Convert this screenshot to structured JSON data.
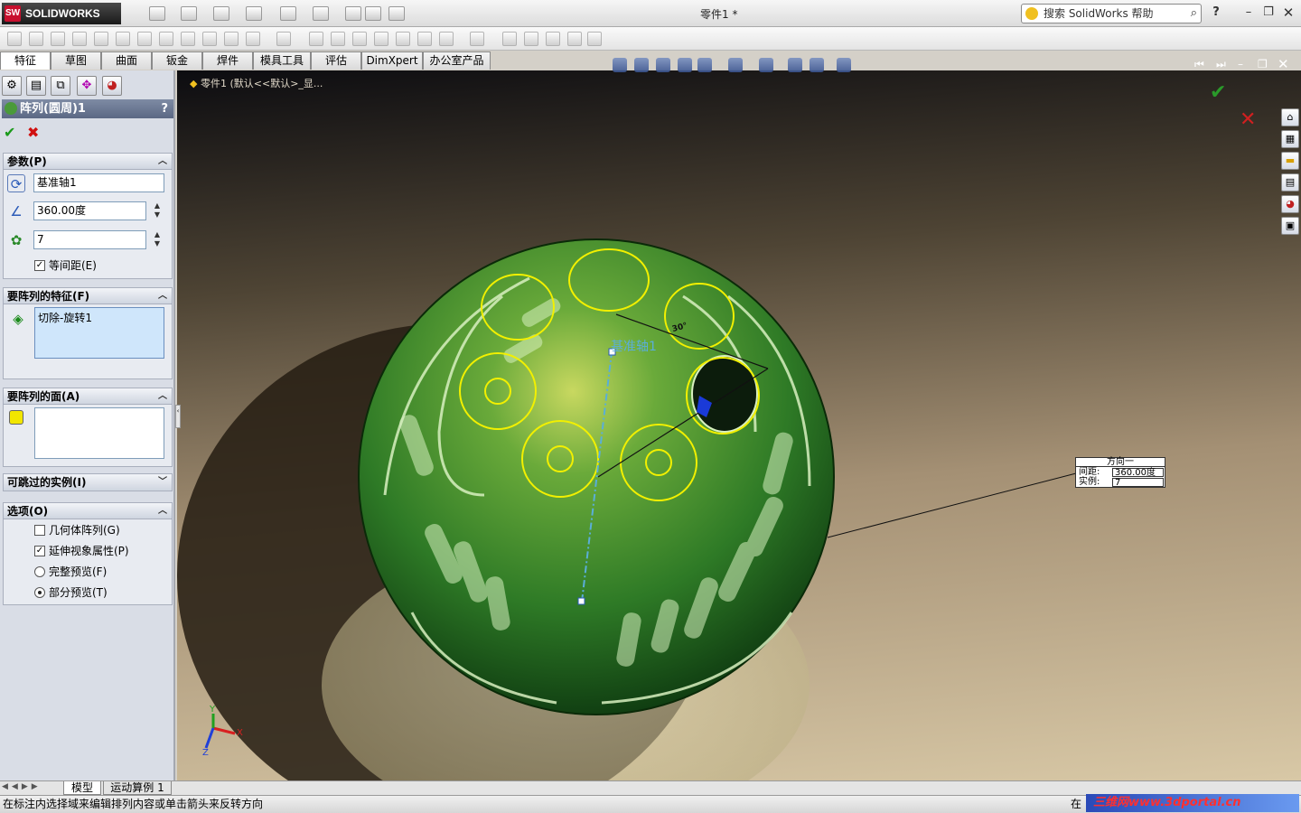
{
  "app": {
    "brand": "SOLIDWORKS",
    "document_title": "零件1 *",
    "search_placeholder": "搜索 SolidWorks 帮助",
    "help_label": "?"
  },
  "command_tabs": [
    {
      "label": "特征",
      "active": true
    },
    {
      "label": "草图"
    },
    {
      "label": "曲面"
    },
    {
      "label": "钣金"
    },
    {
      "label": "焊件"
    },
    {
      "label": "模具工具"
    },
    {
      "label": "评估"
    },
    {
      "label": "DimXpert"
    },
    {
      "label": "办公室产品"
    }
  ],
  "property_manager": {
    "title": "阵列(圆周)1",
    "help": "?",
    "ok_symbol": "✔",
    "cancel_symbol": "✖",
    "groups": {
      "parameters": {
        "title": "参数(P)",
        "axis_value": "基准轴1",
        "angle_value": "360.00度",
        "instances_value": "7",
        "equal_spacing_label": "等间距(E)",
        "equal_spacing_checked": true
      },
      "features": {
        "title": "要阵列的特征(F)",
        "items": [
          "切除-旋转1"
        ]
      },
      "faces": {
        "title": "要阵列的面(A)"
      },
      "skip": {
        "title": "可跳过的实例(I)"
      },
      "options": {
        "title": "选项(O)",
        "geometry_pattern": {
          "label": "几何体阵列(G)",
          "checked": false
        },
        "propagate_visual": {
          "label": "延伸视象属性(P)",
          "checked": true
        },
        "full_preview": {
          "label": "完整预览(F)",
          "selected": false
        },
        "partial_preview": {
          "label": "部分预览(T)",
          "selected": true
        }
      }
    }
  },
  "viewport": {
    "tree_path": "零件1 (默认<<默认>_显...",
    "axis_label": "基准轴1",
    "angle_callout": "30°",
    "direction_box": {
      "title": "方向一",
      "spacing_label": "间距:",
      "spacing_value": "360.00度",
      "instances_label": "实例:",
      "instances_value": "7"
    },
    "triad": {
      "x": "X",
      "y": "Y",
      "z": "Z"
    },
    "colors": {
      "sphere": "#3c8a2c",
      "sketch": "#f2f000",
      "axis": "#5aaed8"
    }
  },
  "bottom_tabs": [
    "模型",
    "运动算例 1"
  ],
  "status_text": "在标注内选择域来编辑排列内容或单击箭头来反转方向",
  "status_right": "在",
  "watermark": "三维网www.3dportal.cn"
}
